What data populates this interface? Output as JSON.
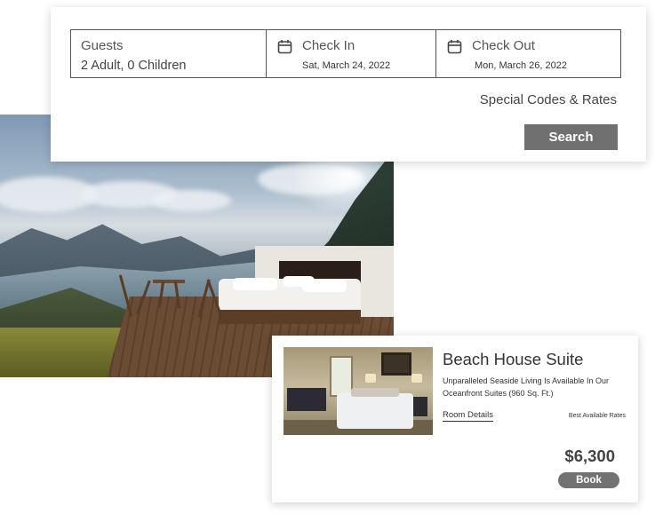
{
  "booking": {
    "guests": {
      "label": "Guests",
      "value": "2 Adult, 0 Children"
    },
    "check_in": {
      "label": "Check In",
      "date": "Sat, March 24, 2022",
      "icon": "calendar-icon"
    },
    "check_out": {
      "label": "Check Out",
      "date": "Mon, March 26, 2022",
      "icon": "calendar-icon"
    },
    "special_codes": "Special Codes & Rates",
    "search_label": "Search"
  },
  "room": {
    "title": "Beach House Suite",
    "description": "Unparalleled Seaside Living Is Available In Our Oceanfront Suites (960 Sq. Ft.)",
    "details_link": "Room Details",
    "rates_label": "Best Available Rates",
    "price": "$6,300",
    "book_label": "Book"
  },
  "colors": {
    "button_gray": "#707070",
    "border": "#555555",
    "text": "#333333"
  }
}
